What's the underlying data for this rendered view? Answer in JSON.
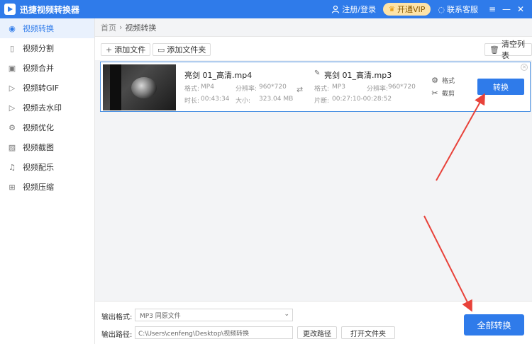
{
  "app": {
    "title": "迅捷视频转换器"
  },
  "titlebar": {
    "login": "注册/登录",
    "vip": "开通VIP",
    "service": "联系客服",
    "menu_icon": "≡",
    "minimize_icon": "—",
    "close_icon": "✕"
  },
  "sidebar": {
    "items": [
      {
        "label": "视频转换",
        "icon": "video-convert-icon"
      },
      {
        "label": "视频分割",
        "icon": "split-icon"
      },
      {
        "label": "视频合并",
        "icon": "merge-icon"
      },
      {
        "label": "视频转GIF",
        "icon": "gif-icon"
      },
      {
        "label": "视频去水印",
        "icon": "watermark-icon"
      },
      {
        "label": "视频优化",
        "icon": "optimize-icon"
      },
      {
        "label": "视频截图",
        "icon": "screenshot-icon"
      },
      {
        "label": "视频配乐",
        "icon": "music-icon"
      },
      {
        "label": "视频压缩",
        "icon": "compress-icon"
      }
    ]
  },
  "breadcrumb": {
    "home": "首页",
    "sep": "›",
    "current": "视频转换"
  },
  "toolbar": {
    "add_file": "添加文件",
    "add_folder": "添加文件夹",
    "clear_list": "清空列表"
  },
  "file": {
    "src_name": "亮剑 01_高清.mp4",
    "src_format_label": "格式:",
    "src_format": "MP4",
    "src_res_label": "分辨率:",
    "src_res": "960*720",
    "src_duration_label": "时长:",
    "src_duration": "00:43:34",
    "src_size_label": "大小:",
    "src_size": "323.04 MB",
    "dst_name": "亮剑 01_高清.mp3",
    "dst_format_label": "格式:",
    "dst_format": "MP3",
    "dst_res_label": "分辨率:",
    "dst_res": "960*720",
    "dst_clip_label": "片断:",
    "dst_clip": "00:27:10-00:28:52",
    "opt_format": "格式",
    "opt_cut": "截剪",
    "convert": "转换"
  },
  "bottom": {
    "format_label": "输出格式:",
    "format_value": "MP3  同原文件",
    "path_label": "输出路径:",
    "path_value": "C:\\Users\\cenfeng\\Desktop\\视频转换",
    "change_path": "更改路径",
    "open_folder": "打开文件夹",
    "convert_all": "全部转换"
  },
  "colors": {
    "accent": "#2f7bea",
    "arrow": "#e8423a",
    "vip_bg": "#fde3a8"
  }
}
